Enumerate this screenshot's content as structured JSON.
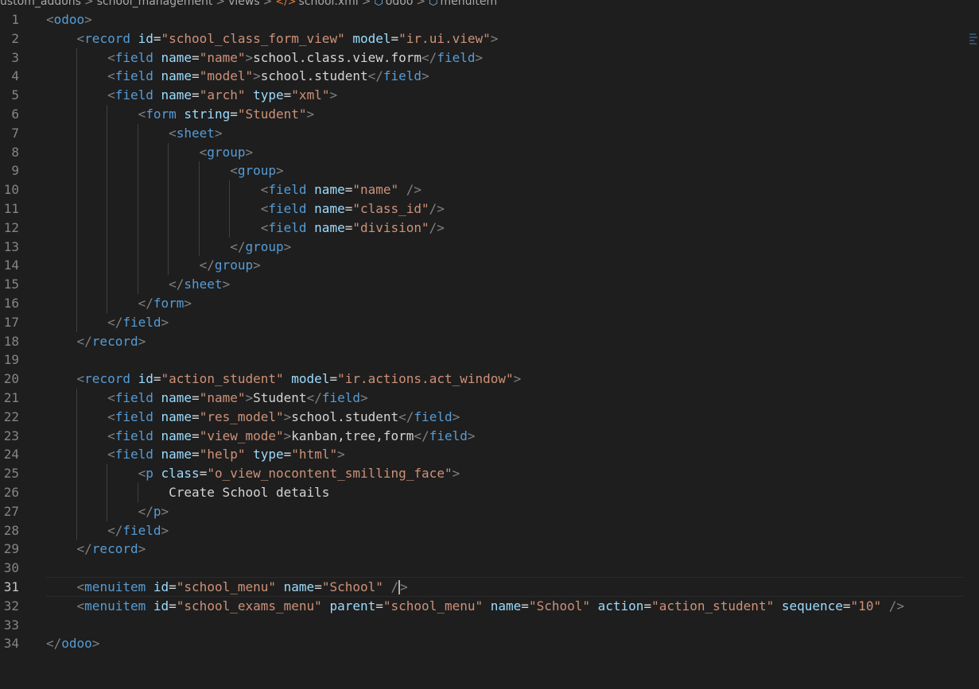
{
  "breadcrumb": {
    "items": [
      "ustom_addons",
      "school_management",
      "views",
      "school.xml",
      "odoo",
      "menuitem"
    ]
  },
  "editor": {
    "active_line": 31,
    "lines": [
      {
        "n": "1",
        "t": [
          [
            "t",
            "<"
          ],
          [
            "tag",
            "odoo"
          ],
          [
            "t",
            ">"
          ]
        ]
      },
      {
        "n": "2",
        "t": [
          [
            "i",
            "    "
          ],
          [
            "t",
            "<"
          ],
          [
            "tag",
            "record"
          ],
          [
            "txt",
            " "
          ],
          [
            "attr",
            "id"
          ],
          [
            "txt",
            "="
          ],
          [
            "str",
            "\"school_class_form_view\""
          ],
          [
            "txt",
            " "
          ],
          [
            "attr",
            "model"
          ],
          [
            "txt",
            "="
          ],
          [
            "str",
            "\"ir.ui.view\""
          ],
          [
            "t",
            ">"
          ]
        ]
      },
      {
        "n": "3",
        "t": [
          [
            "i",
            "        "
          ],
          [
            "t",
            "<"
          ],
          [
            "tag",
            "field"
          ],
          [
            "txt",
            " "
          ],
          [
            "attr",
            "name"
          ],
          [
            "txt",
            "="
          ],
          [
            "str",
            "\"name\""
          ],
          [
            "t",
            ">"
          ],
          [
            "txt",
            "school.class.view.form"
          ],
          [
            "t",
            "</"
          ],
          [
            "tag",
            "field"
          ],
          [
            "t",
            ">"
          ]
        ]
      },
      {
        "n": "4",
        "t": [
          [
            "i",
            "        "
          ],
          [
            "t",
            "<"
          ],
          [
            "tag",
            "field"
          ],
          [
            "txt",
            " "
          ],
          [
            "attr",
            "name"
          ],
          [
            "txt",
            "="
          ],
          [
            "str",
            "\"model\""
          ],
          [
            "t",
            ">"
          ],
          [
            "txt",
            "school.student"
          ],
          [
            "t",
            "</"
          ],
          [
            "tag",
            "field"
          ],
          [
            "t",
            ">"
          ]
        ]
      },
      {
        "n": "5",
        "t": [
          [
            "i",
            "        "
          ],
          [
            "t",
            "<"
          ],
          [
            "tag",
            "field"
          ],
          [
            "txt",
            " "
          ],
          [
            "attr",
            "name"
          ],
          [
            "txt",
            "="
          ],
          [
            "str",
            "\"arch\""
          ],
          [
            "txt",
            " "
          ],
          [
            "attr",
            "type"
          ],
          [
            "txt",
            "="
          ],
          [
            "str",
            "\"xml\""
          ],
          [
            "t",
            ">"
          ]
        ]
      },
      {
        "n": "6",
        "t": [
          [
            "i",
            "            "
          ],
          [
            "t",
            "<"
          ],
          [
            "tag",
            "form"
          ],
          [
            "txt",
            " "
          ],
          [
            "attr",
            "string"
          ],
          [
            "txt",
            "="
          ],
          [
            "str",
            "\"Student\""
          ],
          [
            "t",
            ">"
          ]
        ]
      },
      {
        "n": "7",
        "t": [
          [
            "i",
            "                "
          ],
          [
            "t",
            "<"
          ],
          [
            "tag",
            "sheet"
          ],
          [
            "t",
            ">"
          ]
        ]
      },
      {
        "n": "8",
        "t": [
          [
            "i",
            "                    "
          ],
          [
            "t",
            "<"
          ],
          [
            "tag",
            "group"
          ],
          [
            "t",
            ">"
          ]
        ]
      },
      {
        "n": "9",
        "t": [
          [
            "i",
            "                        "
          ],
          [
            "t",
            "<"
          ],
          [
            "tag",
            "group"
          ],
          [
            "t",
            ">"
          ]
        ]
      },
      {
        "n": "10",
        "t": [
          [
            "i",
            "                            "
          ],
          [
            "t",
            "<"
          ],
          [
            "tag",
            "field"
          ],
          [
            "txt",
            " "
          ],
          [
            "attr",
            "name"
          ],
          [
            "txt",
            "="
          ],
          [
            "str",
            "\"name\""
          ],
          [
            "txt",
            " "
          ],
          [
            "t",
            "/>"
          ]
        ]
      },
      {
        "n": "11",
        "t": [
          [
            "i",
            "                            "
          ],
          [
            "t",
            "<"
          ],
          [
            "tag",
            "field"
          ],
          [
            "txt",
            " "
          ],
          [
            "attr",
            "name"
          ],
          [
            "txt",
            "="
          ],
          [
            "str",
            "\"class_id\""
          ],
          [
            "t",
            "/>"
          ]
        ]
      },
      {
        "n": "12",
        "t": [
          [
            "i",
            "                            "
          ],
          [
            "t",
            "<"
          ],
          [
            "tag",
            "field"
          ],
          [
            "txt",
            " "
          ],
          [
            "attr",
            "name"
          ],
          [
            "txt",
            "="
          ],
          [
            "str",
            "\"division\""
          ],
          [
            "t",
            "/>"
          ]
        ]
      },
      {
        "n": "13",
        "t": [
          [
            "i",
            "                        "
          ],
          [
            "t",
            "</"
          ],
          [
            "tag",
            "group"
          ],
          [
            "t",
            ">"
          ]
        ]
      },
      {
        "n": "14",
        "t": [
          [
            "i",
            "                    "
          ],
          [
            "t",
            "</"
          ],
          [
            "tag",
            "group"
          ],
          [
            "t",
            ">"
          ]
        ]
      },
      {
        "n": "15",
        "t": [
          [
            "i",
            "                "
          ],
          [
            "t",
            "</"
          ],
          [
            "tag",
            "sheet"
          ],
          [
            "t",
            ">"
          ]
        ]
      },
      {
        "n": "16",
        "t": [
          [
            "i",
            "            "
          ],
          [
            "t",
            "</"
          ],
          [
            "tag",
            "form"
          ],
          [
            "t",
            ">"
          ]
        ]
      },
      {
        "n": "17",
        "t": [
          [
            "i",
            "        "
          ],
          [
            "t",
            "</"
          ],
          [
            "tag",
            "field"
          ],
          [
            "t",
            ">"
          ]
        ]
      },
      {
        "n": "18",
        "t": [
          [
            "i",
            "    "
          ],
          [
            "t",
            "</"
          ],
          [
            "tag",
            "record"
          ],
          [
            "t",
            ">"
          ]
        ]
      },
      {
        "n": "19",
        "t": []
      },
      {
        "n": "20",
        "t": [
          [
            "i",
            "    "
          ],
          [
            "t",
            "<"
          ],
          [
            "tag",
            "record"
          ],
          [
            "txt",
            " "
          ],
          [
            "attr",
            "id"
          ],
          [
            "txt",
            "="
          ],
          [
            "str",
            "\"action_student\""
          ],
          [
            "txt",
            " "
          ],
          [
            "attr",
            "model"
          ],
          [
            "txt",
            "="
          ],
          [
            "str",
            "\"ir.actions.act_window\""
          ],
          [
            "t",
            ">"
          ]
        ]
      },
      {
        "n": "21",
        "t": [
          [
            "i",
            "        "
          ],
          [
            "t",
            "<"
          ],
          [
            "tag",
            "field"
          ],
          [
            "txt",
            " "
          ],
          [
            "attr",
            "name"
          ],
          [
            "txt",
            "="
          ],
          [
            "str",
            "\"name\""
          ],
          [
            "t",
            ">"
          ],
          [
            "txt",
            "Student"
          ],
          [
            "t",
            "</"
          ],
          [
            "tag",
            "field"
          ],
          [
            "t",
            ">"
          ]
        ]
      },
      {
        "n": "22",
        "t": [
          [
            "i",
            "        "
          ],
          [
            "t",
            "<"
          ],
          [
            "tag",
            "field"
          ],
          [
            "txt",
            " "
          ],
          [
            "attr",
            "name"
          ],
          [
            "txt",
            "="
          ],
          [
            "str",
            "\"res_model\""
          ],
          [
            "t",
            ">"
          ],
          [
            "txt",
            "school.student"
          ],
          [
            "t",
            "</"
          ],
          [
            "tag",
            "field"
          ],
          [
            "t",
            ">"
          ]
        ]
      },
      {
        "n": "23",
        "t": [
          [
            "i",
            "        "
          ],
          [
            "t",
            "<"
          ],
          [
            "tag",
            "field"
          ],
          [
            "txt",
            " "
          ],
          [
            "attr",
            "name"
          ],
          [
            "txt",
            "="
          ],
          [
            "str",
            "\"view_mode\""
          ],
          [
            "t",
            ">"
          ],
          [
            "txt",
            "kanban,tree,form"
          ],
          [
            "t",
            "</"
          ],
          [
            "tag",
            "field"
          ],
          [
            "t",
            ">"
          ]
        ]
      },
      {
        "n": "24",
        "t": [
          [
            "i",
            "        "
          ],
          [
            "t",
            "<"
          ],
          [
            "tag",
            "field"
          ],
          [
            "txt",
            " "
          ],
          [
            "attr",
            "name"
          ],
          [
            "txt",
            "="
          ],
          [
            "str",
            "\"help\""
          ],
          [
            "txt",
            " "
          ],
          [
            "attr",
            "type"
          ],
          [
            "txt",
            "="
          ],
          [
            "str",
            "\"html\""
          ],
          [
            "t",
            ">"
          ]
        ]
      },
      {
        "n": "25",
        "t": [
          [
            "i",
            "            "
          ],
          [
            "t",
            "<"
          ],
          [
            "tag",
            "p"
          ],
          [
            "txt",
            " "
          ],
          [
            "attr",
            "class"
          ],
          [
            "txt",
            "="
          ],
          [
            "str",
            "\"o_view_nocontent_smilling_face\""
          ],
          [
            "t",
            ">"
          ]
        ]
      },
      {
        "n": "26",
        "t": [
          [
            "i",
            "                "
          ],
          [
            "txt",
            "Create School details"
          ]
        ]
      },
      {
        "n": "27",
        "t": [
          [
            "i",
            "            "
          ],
          [
            "t",
            "</"
          ],
          [
            "tag",
            "p"
          ],
          [
            "t",
            ">"
          ]
        ]
      },
      {
        "n": "28",
        "t": [
          [
            "i",
            "        "
          ],
          [
            "t",
            "</"
          ],
          [
            "tag",
            "field"
          ],
          [
            "t",
            ">"
          ]
        ]
      },
      {
        "n": "29",
        "t": [
          [
            "i",
            "    "
          ],
          [
            "t",
            "</"
          ],
          [
            "tag",
            "record"
          ],
          [
            "t",
            ">"
          ]
        ]
      },
      {
        "n": "30",
        "t": []
      },
      {
        "n": "31",
        "t": [
          [
            "i",
            "    "
          ],
          [
            "t",
            "<"
          ],
          [
            "tag",
            "menuitem"
          ],
          [
            "txt",
            " "
          ],
          [
            "attr",
            "id"
          ],
          [
            "txt",
            "="
          ],
          [
            "str",
            "\"school_menu\""
          ],
          [
            "txt",
            " "
          ],
          [
            "attr",
            "name"
          ],
          [
            "txt",
            "="
          ],
          [
            "str",
            "\"School\""
          ],
          [
            "txt",
            " "
          ],
          [
            "t",
            "/"
          ],
          [
            "cursor",
            ""
          ],
          [
            "t",
            ">"
          ]
        ]
      },
      {
        "n": "32",
        "t": [
          [
            "i",
            "    "
          ],
          [
            "t",
            "<"
          ],
          [
            "tag",
            "menuitem"
          ],
          [
            "txt",
            " "
          ],
          [
            "attr",
            "id"
          ],
          [
            "txt",
            "="
          ],
          [
            "str",
            "\"school_exams_menu\""
          ],
          [
            "txt",
            " "
          ],
          [
            "attr",
            "parent"
          ],
          [
            "txt",
            "="
          ],
          [
            "str",
            "\"school_menu\""
          ],
          [
            "txt",
            " "
          ],
          [
            "attr",
            "name"
          ],
          [
            "txt",
            "="
          ],
          [
            "str",
            "\"School\""
          ],
          [
            "txt",
            " "
          ],
          [
            "attr",
            "action"
          ],
          [
            "txt",
            "="
          ],
          [
            "str",
            "\"action_student\""
          ],
          [
            "txt",
            " "
          ],
          [
            "attr",
            "sequence"
          ],
          [
            "txt",
            "="
          ],
          [
            "str",
            "\"10\""
          ],
          [
            "txt",
            " "
          ],
          [
            "t",
            "/>"
          ]
        ]
      },
      {
        "n": "33",
        "t": []
      },
      {
        "n": "34",
        "t": [
          [
            "t",
            "</"
          ],
          [
            "tag",
            "odoo"
          ],
          [
            "t",
            ">"
          ]
        ]
      }
    ]
  }
}
